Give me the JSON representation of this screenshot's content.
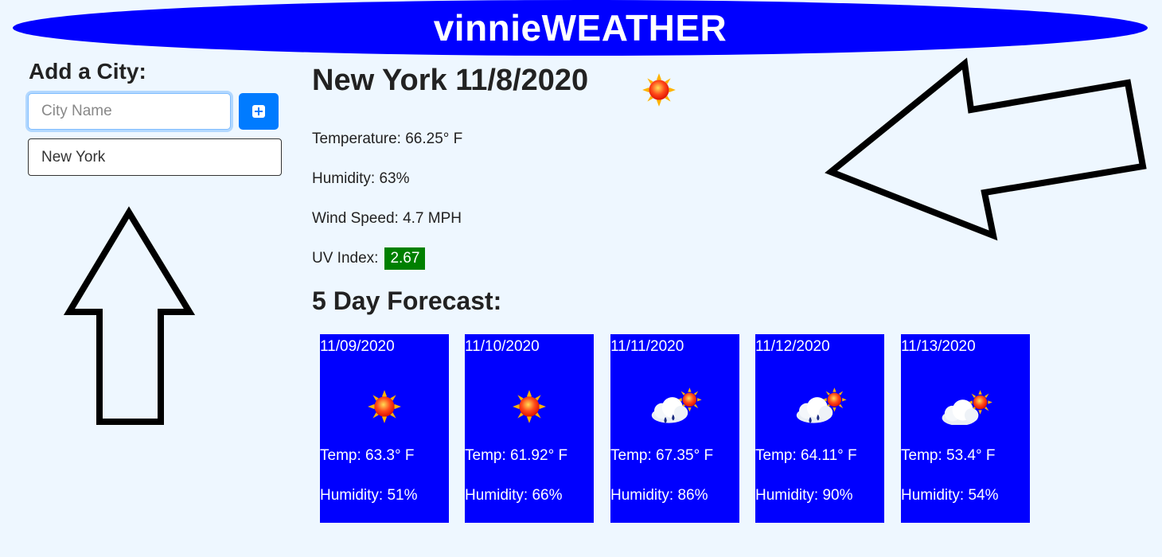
{
  "header": {
    "title": "vinnieWEATHER"
  },
  "sidebar": {
    "add_title": "Add a City:",
    "input_placeholder": "City Name",
    "input_value": "",
    "add_button_icon": "plus-square-icon",
    "saved_cities": [
      "New York"
    ]
  },
  "current": {
    "title": "New York 11/8/2020",
    "icon": "sun-icon",
    "temperature": "Temperature: 66.25° F",
    "humidity": "Humidity: 63%",
    "wind": "Wind Speed: 4.7 MPH",
    "uv_label": "UV Index:",
    "uv_value": "2.67",
    "uv_color": "#008000"
  },
  "forecast": {
    "title": "5 Day Forecast:",
    "card_color": "#0000ff",
    "days": [
      {
        "date": "11/09/2020",
        "icon": "sun-icon",
        "temp": "Temp: 63.3° F",
        "humidity": "Humidity: 51%"
      },
      {
        "date": "11/10/2020",
        "icon": "sun-icon",
        "temp": "Temp: 61.92° F",
        "humidity": "Humidity: 66%"
      },
      {
        "date": "11/11/2020",
        "icon": "rain-cloud-sun-icon",
        "temp": "Temp: 67.35° F",
        "humidity": "Humidity: 86%"
      },
      {
        "date": "11/12/2020",
        "icon": "rain-cloud-sun-icon",
        "temp": "Temp: 64.11° F",
        "humidity": "Humidity: 90%"
      },
      {
        "date": "11/13/2020",
        "icon": "cloud-sun-icon",
        "temp": "Temp: 53.4° F",
        "humidity": "Humidity: 54%"
      }
    ]
  },
  "annotations": [
    "arrow-up-icon",
    "arrow-left-icon"
  ]
}
